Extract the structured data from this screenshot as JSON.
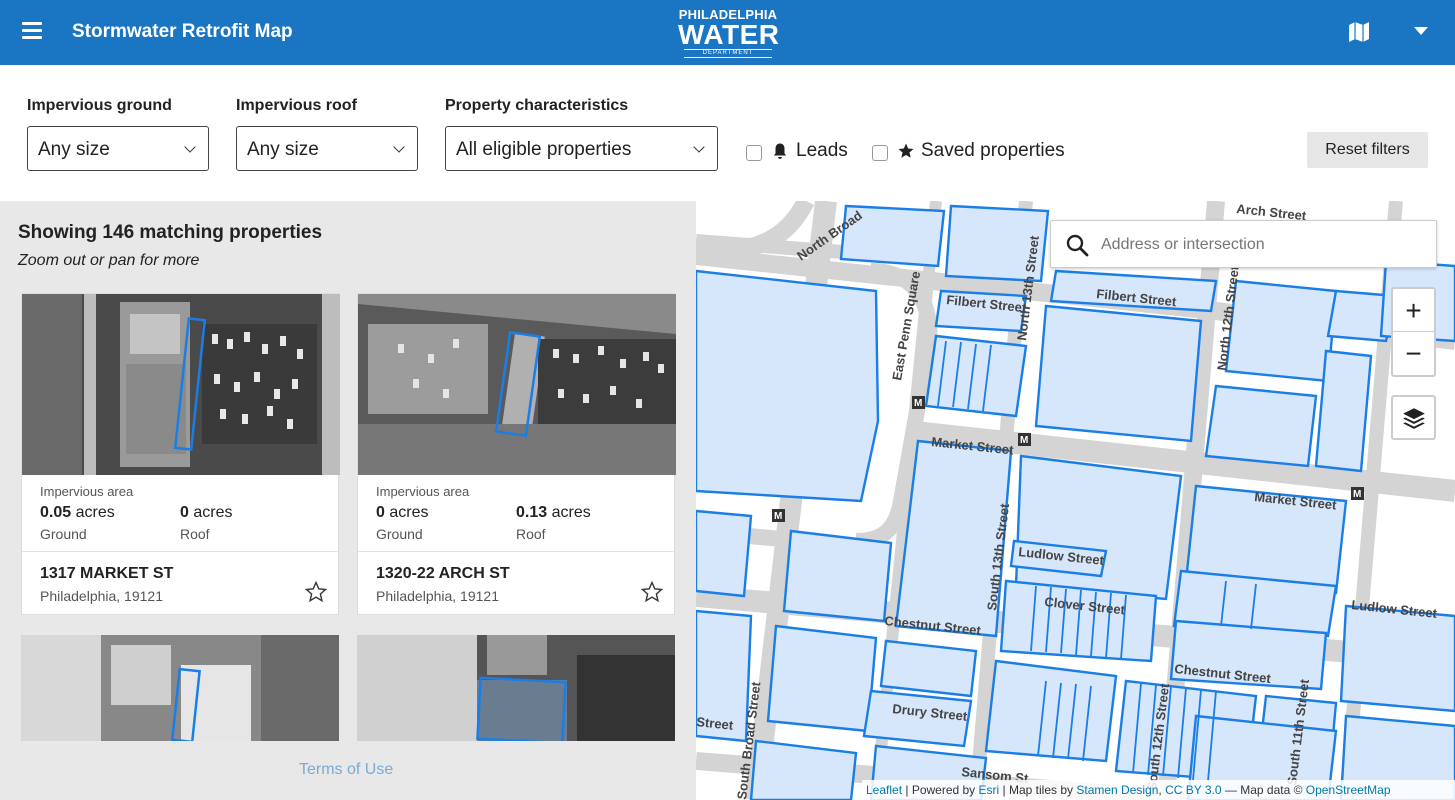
{
  "header": {
    "title": "Stormwater Retrofit Map",
    "logo_line1": "PHILADELPHIA",
    "logo_line2": "WATER",
    "logo_line3": "DEPARTMENT"
  },
  "filters": {
    "ground_label": "Impervious ground",
    "ground_value": "Any size",
    "roof_label": "Impervious roof",
    "roof_value": "Any size",
    "characteristics_label": "Property characteristics",
    "characteristics_value": "All eligible properties",
    "leads_label": "Leads",
    "saved_label": "Saved properties",
    "reset_label": "Reset filters"
  },
  "results": {
    "count_text": "Showing 146 matching properties",
    "hint_text": "Zoom out or pan for more",
    "impervious_label": "Impervious area",
    "unit": "acres",
    "ground_word": "Ground",
    "roof_word": "Roof",
    "cards": [
      {
        "ground": "0.05",
        "roof": "0",
        "address": "1317 MARKET ST",
        "city": "Philadelphia, 19121"
      },
      {
        "ground": "0",
        "roof": "0.13",
        "address": "1320-22 ARCH ST",
        "city": "Philadelphia, 19121"
      }
    ],
    "terms": "Terms of Use"
  },
  "map": {
    "search_placeholder": "Address or intersection",
    "zoom_in": "+",
    "zoom_out": "−",
    "streets": [
      "North Broad",
      "Arch Street",
      "Filbert Street",
      "East Penn Square",
      "North 13th Street",
      "North 12th Street",
      "Market Street",
      "South 13th Street",
      "Ludlow Street",
      "Clover Street",
      "Chestnut Street",
      "Drury Street",
      "Sansom St",
      "South 12th Street",
      "South Broad Street",
      "South 11th Street",
      "Juniper Street"
    ],
    "attribution": {
      "leaflet": "Leaflet",
      "sep1": " | Powered by ",
      "esri": "Esri",
      "sep2": " | Map tiles by ",
      "stamen": "Stamen Design",
      "sep3": ", ",
      "cc": "CC BY 3.0",
      "sep4": " — Map data © ",
      "osm": "OpenStreetMap"
    }
  },
  "colors": {
    "brand": "#1a75c2",
    "parcel_fill": "#d6e6fb",
    "parcel_stroke": "#1a7ee6"
  }
}
